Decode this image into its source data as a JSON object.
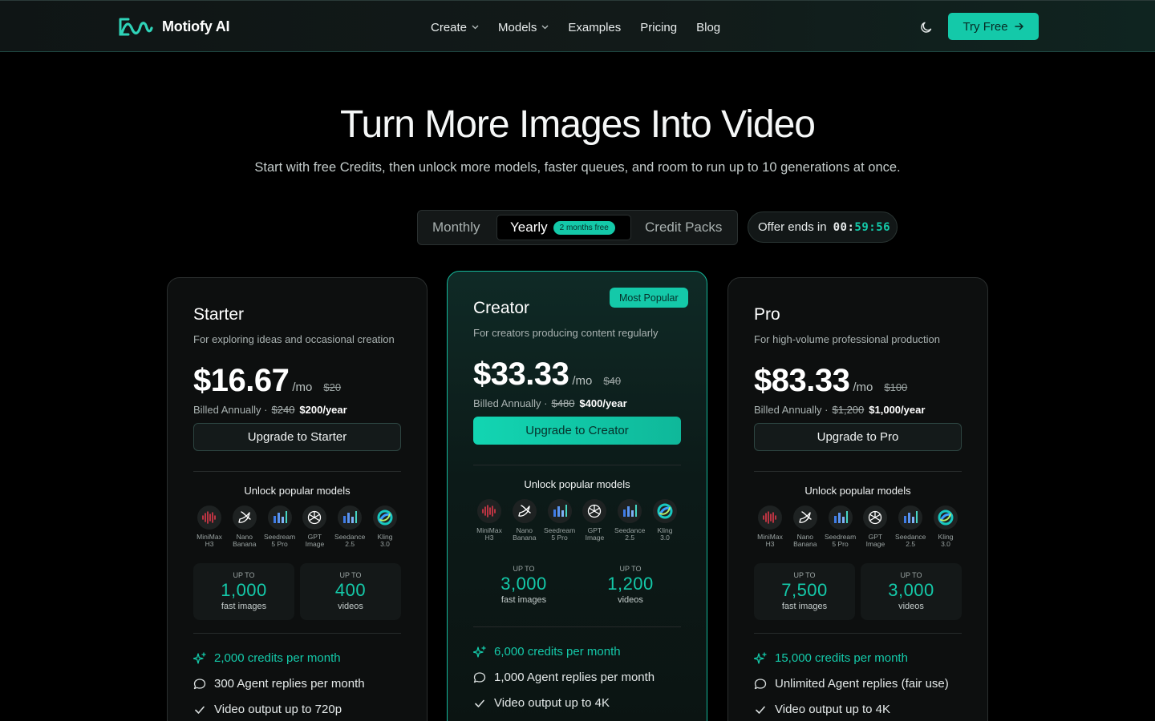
{
  "nav": {
    "brand": "Motiofy AI",
    "links": [
      {
        "label": "Create",
        "dropdown": true
      },
      {
        "label": "Models",
        "dropdown": true
      },
      {
        "label": "Examples",
        "dropdown": false
      },
      {
        "label": "Pricing",
        "dropdown": false
      },
      {
        "label": "Blog",
        "dropdown": false
      }
    ],
    "try_label": "Try Free"
  },
  "hero": {
    "title": "Turn More Images Into Video",
    "subtitle": "Start with free Credits, then unlock more models, faster queues, and room to run up to 10 generations at once."
  },
  "billing": {
    "monthly": "Monthly",
    "yearly": "Yearly",
    "yearly_badge": "2 months free",
    "packs": "Credit Packs",
    "selected": "Yearly"
  },
  "offer": {
    "label": "Offer ends in",
    "time_a": "00:",
    "time_b": "59:56"
  },
  "colors": {
    "accent": "#14c9a9",
    "background": "#000000"
  },
  "plans": [
    {
      "name": "Starter",
      "desc": "For exploring ideas and occasional creation",
      "price": "$16.67",
      "per": "/mo",
      "old_price": "$20",
      "billed_label": "Billed Annually ·",
      "billed_old": "$240",
      "billed_new": "$200/year",
      "button": "Upgrade to Starter",
      "unlock": "Unlock popular models",
      "quota_prefix": "UP TO",
      "quotas": [
        {
          "num": "1,000",
          "unit": "fast images"
        },
        {
          "num": "400",
          "unit": "videos"
        }
      ],
      "features": [
        {
          "icon": "sparkle-icon",
          "text": "2,000 credits per month"
        },
        {
          "icon": "chat-bubble-icon",
          "text": "300 Agent replies per month"
        },
        {
          "icon": "check-icon",
          "text": "Video output up to 720p"
        }
      ]
    },
    {
      "name": "Creator",
      "badge": "Most Popular",
      "desc": "For creators producing content regularly",
      "price": "$33.33",
      "per": "/mo",
      "old_price": "$40",
      "billed_label": "Billed Annually ·",
      "billed_old": "$480",
      "billed_new": "$400/year",
      "button": "Upgrade to Creator",
      "unlock": "Unlock popular models",
      "quota_prefix": "UP TO",
      "quotas": [
        {
          "num": "3,000",
          "unit": "fast images"
        },
        {
          "num": "1,200",
          "unit": "videos"
        }
      ],
      "features": [
        {
          "icon": "sparkle-icon",
          "text": "6,000 credits per month"
        },
        {
          "icon": "chat-bubble-icon",
          "text": "1,000 Agent replies per month"
        },
        {
          "icon": "check-icon",
          "text": "Video output up to 4K"
        }
      ]
    },
    {
      "name": "Pro",
      "desc": "For high-volume professional production",
      "price": "$83.33",
      "per": "/mo",
      "old_price": "$100",
      "billed_label": "Billed Annually ·",
      "billed_old": "$1,200",
      "billed_new": "$1,000/year",
      "button": "Upgrade to Pro",
      "unlock": "Unlock popular models",
      "quota_prefix": "UP TO",
      "quotas": [
        {
          "num": "7,500",
          "unit": "fast images"
        },
        {
          "num": "3,000",
          "unit": "videos"
        }
      ],
      "features": [
        {
          "icon": "sparkle-icon",
          "text": "15,000 credits per month"
        },
        {
          "icon": "chat-bubble-icon",
          "text": "Unlimited Agent replies (fair use)"
        },
        {
          "icon": "check-icon",
          "text": "Video output up to 4K"
        }
      ]
    }
  ],
  "models": [
    {
      "label": "MiniMax\nH3",
      "icon": "waveform-icon"
    },
    {
      "label": "Nano\nBanana",
      "icon": "banana-icon"
    },
    {
      "label": "Seedream\n5 Pro",
      "icon": "bar-chart-icon"
    },
    {
      "label": "GPT\nImage",
      "icon": "openai-icon"
    },
    {
      "label": "Seedance\n2.5",
      "icon": "bar-chart-icon"
    },
    {
      "label": "Kling\n3.0",
      "icon": "swirl-icon"
    }
  ]
}
